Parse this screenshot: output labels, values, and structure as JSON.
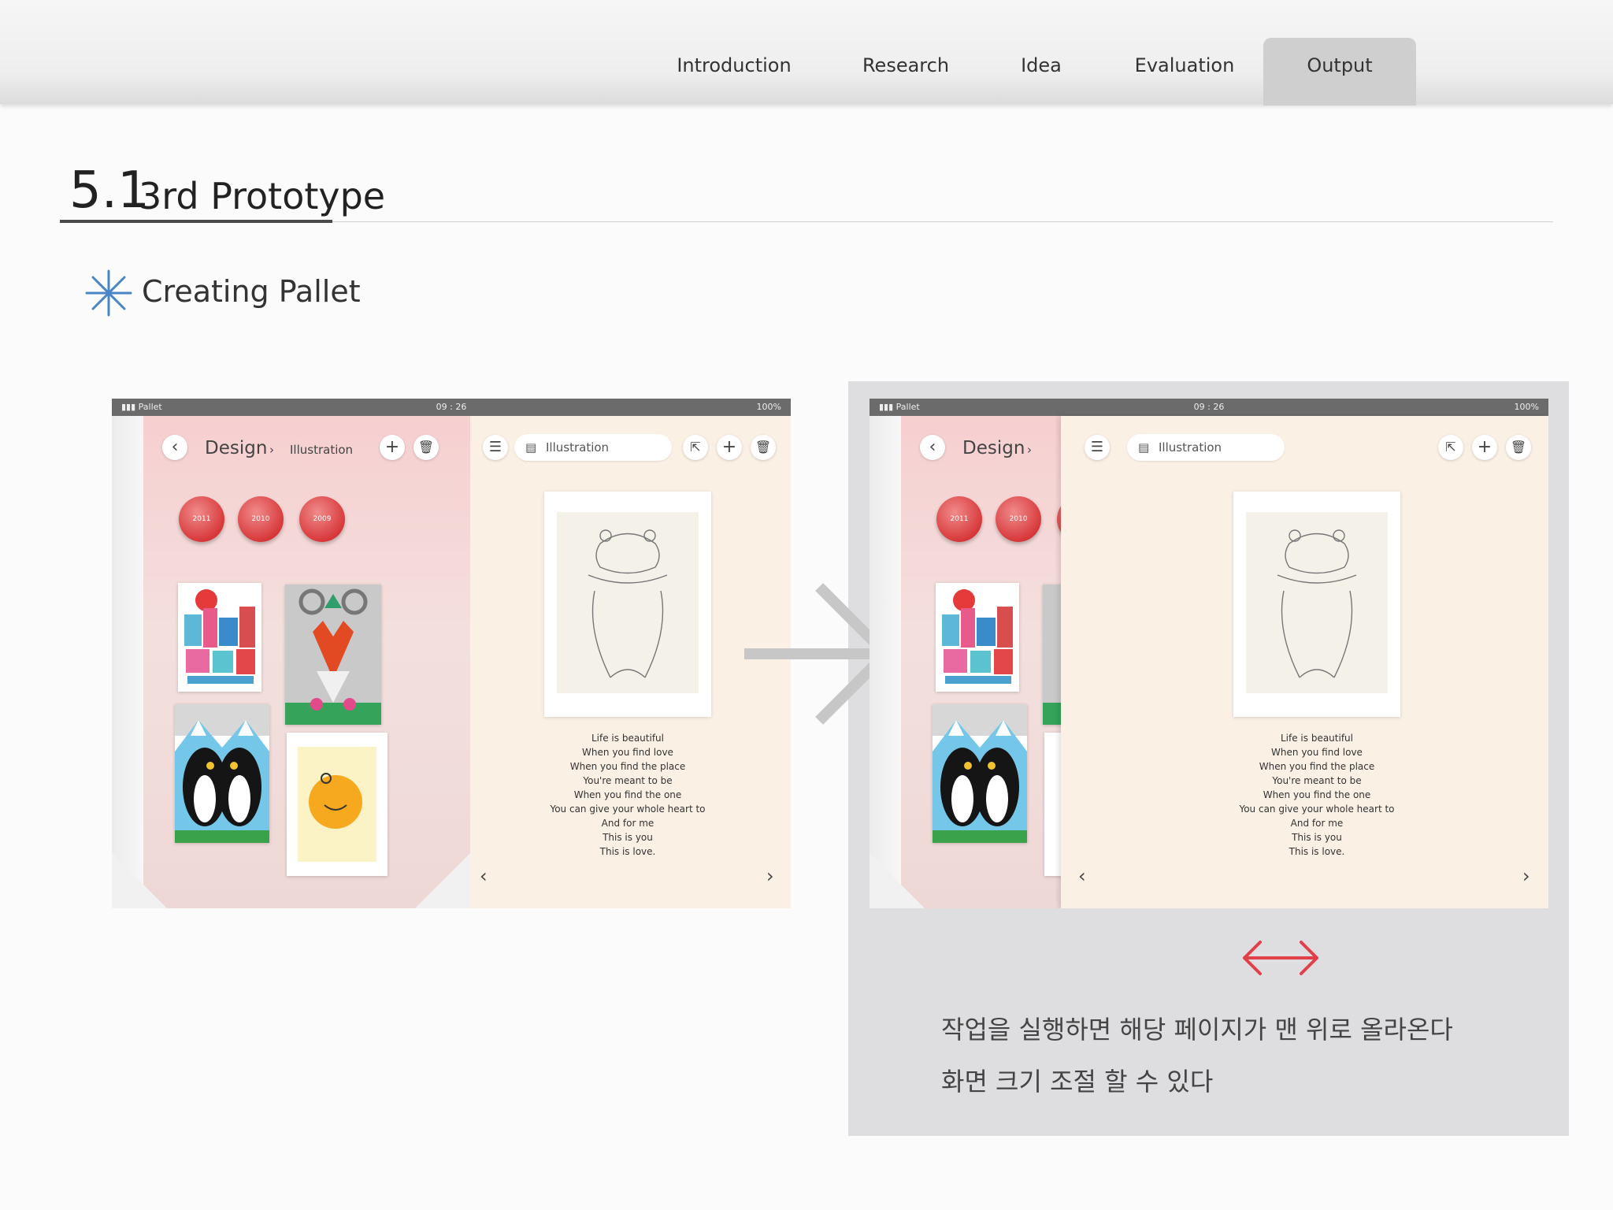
{
  "nav": {
    "items": [
      "Introduction",
      "Research",
      "Idea",
      "Evaluation",
      "Output"
    ],
    "active": "Output"
  },
  "heading": {
    "number": "5.1",
    "title": "3rd Prototype"
  },
  "subheading": "Creating Pallet",
  "tablet": {
    "status_carrier": "Pallet",
    "status_time": "09 : 26",
    "status_battery": "100%",
    "crumb_parent": "Design",
    "crumb_child": "Illustration",
    "search_label": "Illustration",
    "years": [
      "2011",
      "2010",
      "2009"
    ],
    "poem": [
      "Life is beautiful",
      "When you find love",
      "When you find the place",
      "You're meant to be",
      "When you find the one",
      "You can give your whole heart to",
      "And for me",
      "This is you",
      "This is love."
    ],
    "prev": "‹",
    "next": "›"
  },
  "notes": {
    "line1": "작업을 실행하면 해당 페이지가 맨 위로 올라온다",
    "line2": "화면 크기 조절 할 수 있다"
  },
  "colors": {
    "accent_blue": "#4a86c5",
    "resize_arrow": "#e0404a",
    "active_tab": "#cfcfcf",
    "gray_panel": "#dedee0"
  },
  "icons": [
    "asterisk-icon",
    "back-icon",
    "plus-icon",
    "trash-icon",
    "list-icon",
    "document-icon",
    "share-icon",
    "transition-arrow-icon",
    "resize-arrow-icon"
  ]
}
